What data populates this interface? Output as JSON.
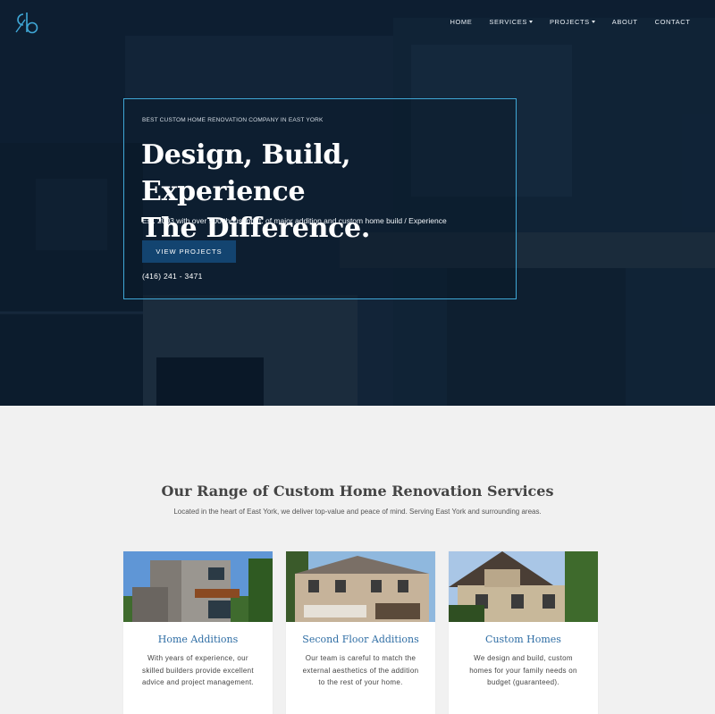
{
  "nav": {
    "items": [
      {
        "label": "HOME",
        "caret": false
      },
      {
        "label": "SERVICES",
        "caret": true
      },
      {
        "label": "PROJECTS",
        "caret": true
      },
      {
        "label": "ABOUT",
        "caret": false
      },
      {
        "label": "CONTACT",
        "caret": false
      }
    ]
  },
  "hero": {
    "eyebrow": "BEST CUSTOM HOME RENOVATION COMPANY IN EAST YORK",
    "headline_line1": "Design, Build, Experience",
    "headline_line2": "The Difference.",
    "subline": "Est. 2003 with over 900 thousand ft. of major addition and custom home build / Experience",
    "cta_label": "VIEW PROJECTS",
    "phone": "(416) 241 - 3471"
  },
  "services": {
    "title": "Our Range of Custom Home Renovation Services",
    "subtitle": "Located in the heart of East York, we deliver top-value and peace of mind. Serving East York and surrounding areas.",
    "cards": [
      {
        "title": "Home Additions",
        "text": "With years of experience, our skilled builders provide excellent advice and project management."
      },
      {
        "title": "Second Floor Additions",
        "text": "Our team is careful to match the external aesthetics of the addition to the rest of your home."
      },
      {
        "title": "Custom Homes",
        "text": "We design and build, custom homes for your family needs on budget (guaranteed)."
      }
    ]
  },
  "colors": {
    "hero_border": "#3fa7d6",
    "cta_bg": "#134470",
    "card_title": "#2e6da4",
    "page_bg": "#f1f1f1"
  }
}
